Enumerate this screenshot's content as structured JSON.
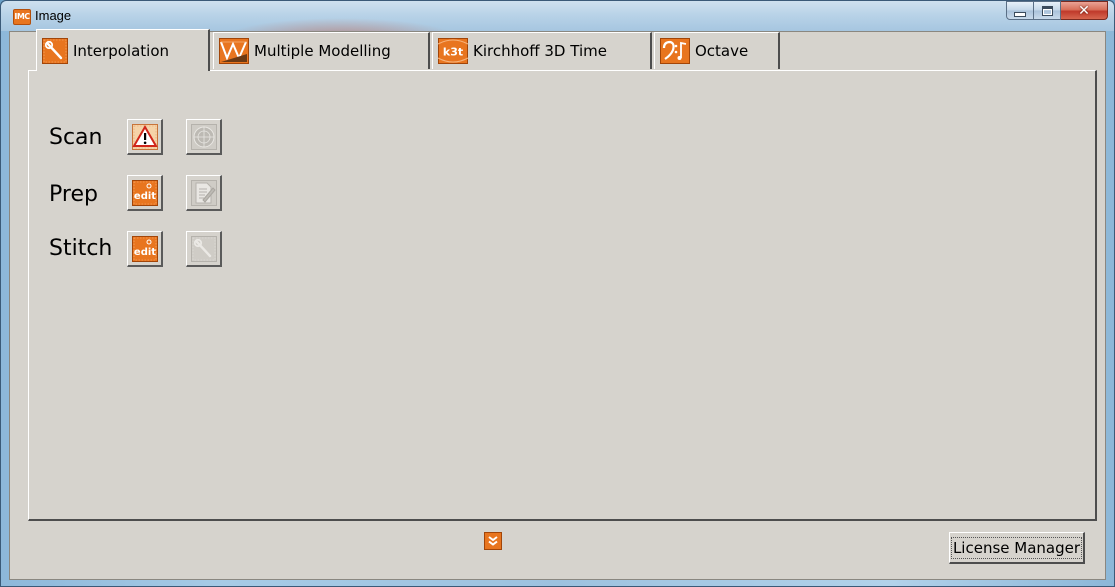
{
  "window": {
    "title": "Image",
    "app_icon_text": "IMG",
    "controls": [
      "minimize",
      "maximize",
      "close"
    ]
  },
  "tabs": [
    {
      "label": "Interpolation",
      "icon": "interpolation-icon",
      "active": true
    },
    {
      "label": "Multiple Modelling",
      "icon": "multiple-modelling-icon",
      "active": false
    },
    {
      "label": "Kirchhoff 3D Time",
      "icon": "k3t-icon",
      "icon_text": "k3t",
      "active": false
    },
    {
      "label": "Octave",
      "icon": "octave-icon",
      "active": false
    }
  ],
  "rows": [
    {
      "label": "Scan",
      "tools": [
        {
          "icon": "warning-icon",
          "enabled": true
        },
        {
          "icon": "radar-icon",
          "enabled": false
        }
      ]
    },
    {
      "label": "Prep",
      "tools": [
        {
          "icon": "edit-icon",
          "text": "edit",
          "enabled": true
        },
        {
          "icon": "document-edit-icon",
          "enabled": false
        }
      ]
    },
    {
      "label": "Stitch",
      "tools": [
        {
          "icon": "edit-icon",
          "text": "edit",
          "enabled": true
        },
        {
          "icon": "interpolation-icon",
          "enabled": false
        }
      ]
    }
  ],
  "footer": {
    "expand_icon": "double-chevron-down-icon",
    "license_button_label": "License Manager"
  },
  "colors": {
    "accent_orange": "#e8751f",
    "panel_bg": "#d6d3cd"
  }
}
